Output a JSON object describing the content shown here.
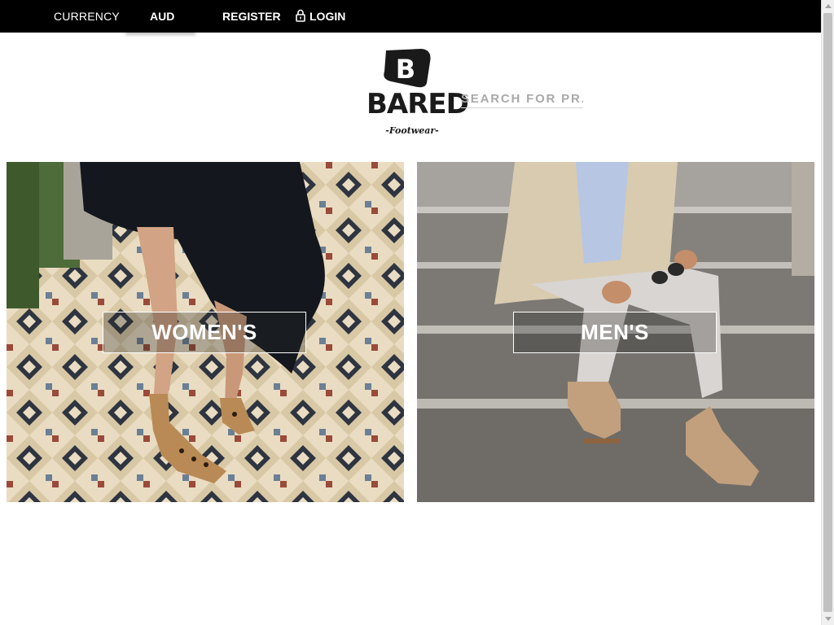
{
  "topbar": {
    "currency_label": "CURRENCY",
    "currency_value": "AUD",
    "register": "REGISTER",
    "login": "LOGIN"
  },
  "logo": {
    "brand": "BARED",
    "tagline": "-Footwear-"
  },
  "search": {
    "placeholder": "SEARCH FOR PR..."
  },
  "categories": [
    {
      "label": "WOMEN'S",
      "image": "woman-legs-leopard-heels-on-tiled-floor"
    },
    {
      "label": "MEN'S",
      "image": "man-seated-on-stairs-suede-tassel-loafers"
    }
  ],
  "colors": {
    "topbar_bg": "#000000",
    "topbar_text": "#ffffff",
    "brand": "#1a1a1a"
  },
  "icons": [
    "lock-icon"
  ]
}
